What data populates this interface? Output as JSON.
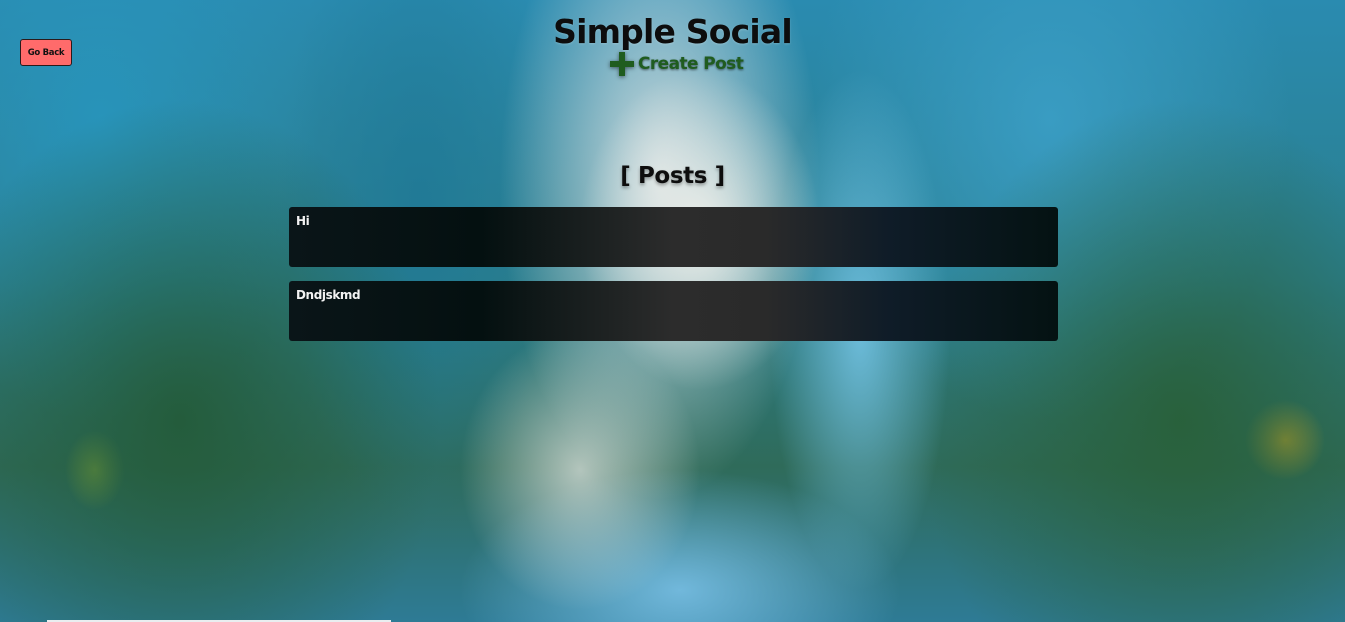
{
  "nav": {
    "go_back_label": "Go Back"
  },
  "header": {
    "title": "Simple Social",
    "create_post_label": "Create Post",
    "create_post_icon": "plus-icon"
  },
  "posts_section": {
    "heading": "[ Posts ]",
    "posts": [
      {
        "text": "Hi"
      },
      {
        "text": "Dndjskmd"
      }
    ]
  },
  "colors": {
    "go_back_button": "#ff6b6b",
    "create_post": "#1f5c1f",
    "post_card_dark": "#041010",
    "post_card_mid": "#2c2c2c",
    "post_text": "#f2f2f2"
  }
}
